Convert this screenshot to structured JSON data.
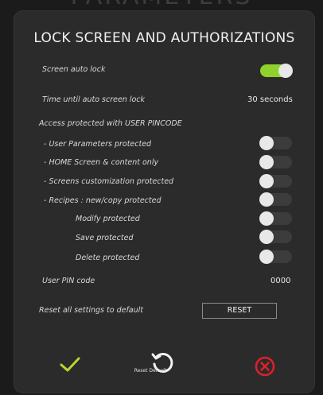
{
  "background_title": "PARAMETERS",
  "dialog": {
    "title": "LOCK SCREEN AND AUTHORIZATIONS"
  },
  "settings": {
    "screen_auto_lock": {
      "label": "Screen auto lock",
      "value": true
    },
    "time_until_lock": {
      "label": "Time until auto screen lock",
      "value": "30 seconds"
    },
    "access_header": "Access protected with USER PINCODE",
    "protections": [
      {
        "label": "- User Parameters  protected",
        "value": false
      },
      {
        "label": "- HOME Screen & content only",
        "value": false
      },
      {
        "label": "- Screens customization protected",
        "value": false
      },
      {
        "label": "- Recipes : new/copy protected",
        "value": false
      },
      {
        "label": "Modify protected",
        "value": false
      },
      {
        "label": "Save protected",
        "value": false
      },
      {
        "label": "Delete protected",
        "value": false
      }
    ],
    "pin": {
      "label": "User PIN code",
      "value": "0000"
    },
    "reset": {
      "label": "Reset all settings to default",
      "button": "RESET"
    }
  },
  "footer": {
    "confirm_icon": "check-icon",
    "reset_default_icon": "undo-icon",
    "reset_default_label": "Reset Default",
    "cancel_icon": "cancel-circle-icon"
  },
  "colors": {
    "accent_green": "#8fd22b",
    "cancel_red": "#e0202a",
    "confirm_green": "#b9d62e"
  }
}
